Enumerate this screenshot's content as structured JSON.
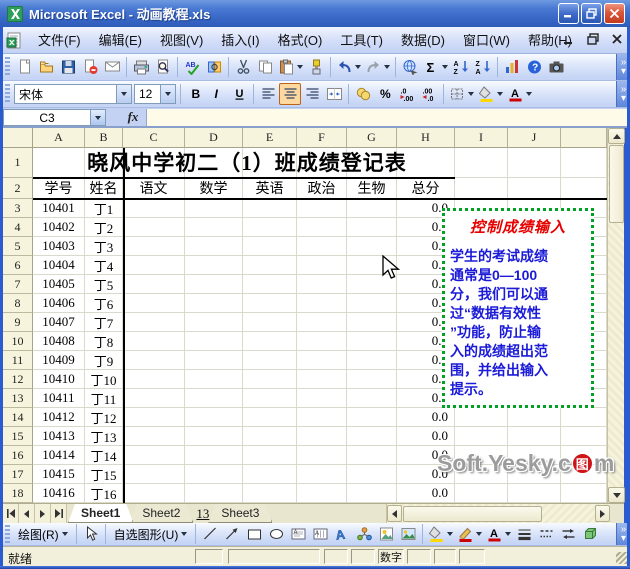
{
  "window": {
    "title": "Microsoft Excel - 动画教程.xls"
  },
  "menu": {
    "items": [
      "文件(F)",
      "编辑(E)",
      "视图(V)",
      "插入(I)",
      "格式(O)",
      "工具(T)",
      "数据(D)",
      "窗口(W)",
      "帮助(H)"
    ]
  },
  "toolbar_standard": {
    "buttons": [
      {
        "name": "new"
      },
      {
        "name": "open"
      },
      {
        "name": "save"
      },
      {
        "name": "permission"
      },
      {
        "name": "email"
      },
      {
        "sep": true
      },
      {
        "name": "print"
      },
      {
        "name": "print-preview"
      },
      {
        "sep": true
      },
      {
        "name": "spelling"
      },
      {
        "name": "research"
      },
      {
        "sep": true
      },
      {
        "name": "cut"
      },
      {
        "name": "copy"
      },
      {
        "name": "paste",
        "dd": true
      },
      {
        "name": "format-painter"
      },
      {
        "sep": true
      },
      {
        "name": "undo",
        "dd": true
      },
      {
        "name": "redo",
        "dd": true
      },
      {
        "sep": true
      },
      {
        "name": "hyperlink"
      },
      {
        "name": "autosum",
        "dd": true
      },
      {
        "name": "sort-ascending"
      },
      {
        "name": "sort-descending"
      },
      {
        "sep": true
      },
      {
        "name": "chart-wizard"
      },
      {
        "name": "help"
      },
      {
        "name": "camera"
      }
    ]
  },
  "toolbar_formatting": {
    "font_name": "宋体",
    "font_size": "12",
    "buttons": [
      {
        "name": "bold"
      },
      {
        "name": "italic"
      },
      {
        "name": "underline"
      },
      {
        "sep": true
      },
      {
        "name": "align-left"
      },
      {
        "name": "align-center",
        "active": true
      },
      {
        "name": "align-right"
      },
      {
        "name": "merge-center"
      },
      {
        "sep": true
      },
      {
        "name": "currency"
      },
      {
        "name": "percent"
      },
      {
        "name": "increase-decimal"
      },
      {
        "name": "decrease-decimal"
      },
      {
        "sep": true
      },
      {
        "name": "borders",
        "dd": true
      },
      {
        "name": "fill-color",
        "dd": true
      },
      {
        "name": "font-color",
        "dd": true
      }
    ]
  },
  "formula_bar": {
    "name_box": "C3",
    "fx_label": "fx"
  },
  "grid": {
    "columns": [
      "A",
      "B",
      "C",
      "D",
      "E",
      "F",
      "G",
      "H",
      "I",
      "J",
      ""
    ],
    "title_row_number": "1",
    "header_row_number": "2",
    "title": "晓风中学初二（1）班成绩登记表",
    "header_row": [
      "学号",
      "姓名",
      "语文",
      "数学",
      "英语",
      "政治",
      "生物",
      "总分"
    ],
    "rows": [
      {
        "num": "3",
        "id": "10401",
        "name": "丁1",
        "total": "0.0"
      },
      {
        "num": "4",
        "id": "10402",
        "name": "丁2",
        "total": "0.0"
      },
      {
        "num": "5",
        "id": "10403",
        "name": "丁3",
        "total": "0.0"
      },
      {
        "num": "6",
        "id": "10404",
        "name": "丁4",
        "total": "0.0"
      },
      {
        "num": "7",
        "id": "10405",
        "name": "丁5",
        "total": "0.0"
      },
      {
        "num": "8",
        "id": "10406",
        "name": "丁6",
        "total": "0.0"
      },
      {
        "num": "9",
        "id": "10407",
        "name": "丁7",
        "total": "0.0"
      },
      {
        "num": "10",
        "id": "10408",
        "name": "丁8",
        "total": "0.0"
      },
      {
        "num": "11",
        "id": "10409",
        "name": "丁9",
        "total": "0.0"
      },
      {
        "num": "12",
        "id": "10410",
        "name": "丁10",
        "total": "0.0"
      },
      {
        "num": "13",
        "id": "10411",
        "name": "丁11",
        "total": "0.0"
      },
      {
        "num": "14",
        "id": "10412",
        "name": "丁12",
        "total": "0.0"
      },
      {
        "num": "15",
        "id": "10413",
        "name": "丁13",
        "total": "0.0"
      },
      {
        "num": "16",
        "id": "10414",
        "name": "丁14",
        "total": "0.0"
      },
      {
        "num": "17",
        "id": "10415",
        "name": "丁15",
        "total": "0.0"
      },
      {
        "num": "18",
        "id": "10416",
        "name": "丁16",
        "total": "0.0"
      }
    ]
  },
  "note_box": {
    "title": "控制成绩输入",
    "lines": [
      "学生的考试成绩",
      "通常是0—100",
      "分，我们可以通",
      "过“数据有效性",
      "”功能，防止输",
      "入的成绩超出范",
      "围，并给出输入",
      "提示。"
    ],
    "border_color": "#00a226",
    "title_color": "#e60000",
    "body_color": "#1a1ad8"
  },
  "watermark": {
    "before": "Soft.Yesky.c",
    "logo": "图",
    "after": "m"
  },
  "sheet_tabs": {
    "tabs": [
      {
        "label": "Sheet1",
        "active": true
      },
      {
        "label": "Sheet2"
      },
      {
        "label": "13",
        "page_marker": true
      },
      {
        "label": "Sheet3"
      }
    ]
  },
  "drawing_toolbar": {
    "draw_label": "绘图(R)",
    "autoshapes_label": "自选图形(U)",
    "buttons": [
      {
        "name": "line"
      },
      {
        "name": "arrow"
      },
      {
        "name": "rectangle"
      },
      {
        "name": "oval"
      },
      {
        "name": "text-box"
      },
      {
        "name": "vertical-text-box"
      },
      {
        "name": "wordart"
      },
      {
        "name": "diagram"
      },
      {
        "name": "clip-art"
      },
      {
        "name": "picture"
      },
      {
        "sep": true
      },
      {
        "name": "fill-color",
        "dd": true
      },
      {
        "name": "line-color",
        "dd": true
      },
      {
        "name": "font-color",
        "dd": true
      },
      {
        "name": "line-style"
      },
      {
        "name": "dash-style"
      },
      {
        "name": "arrow-style"
      },
      {
        "name": "3d-style"
      }
    ]
  },
  "status_bar": {
    "ready": "就绪",
    "num_indicator": "数字"
  }
}
